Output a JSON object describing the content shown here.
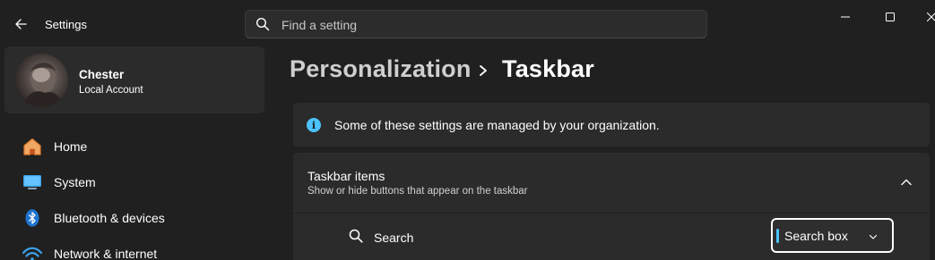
{
  "window": {
    "title": "Settings"
  },
  "search": {
    "placeholder": "Find a setting",
    "value": ""
  },
  "account": {
    "name": "Chester",
    "type": "Local Account"
  },
  "nav": {
    "items": [
      {
        "label": "Home",
        "icon": "home-icon"
      },
      {
        "label": "System",
        "icon": "monitor-icon"
      },
      {
        "label": "Bluetooth & devices",
        "icon": "bluetooth-icon"
      },
      {
        "label": "Network & internet",
        "icon": "wifi-icon"
      }
    ]
  },
  "breadcrumb": {
    "parent": "Personalization",
    "current": "Taskbar"
  },
  "info": {
    "text": "Some of these settings are managed by your organization."
  },
  "taskbar_items": {
    "title": "Taskbar items",
    "subtitle": "Show or hide buttons that appear on the taskbar",
    "expanded": true,
    "rows": [
      {
        "label": "Search",
        "icon": "search-icon",
        "selected": "Search box"
      }
    ]
  },
  "colors": {
    "accent": "#4cc2ff",
    "background": "#202020",
    "card": "#2b2b2b"
  }
}
